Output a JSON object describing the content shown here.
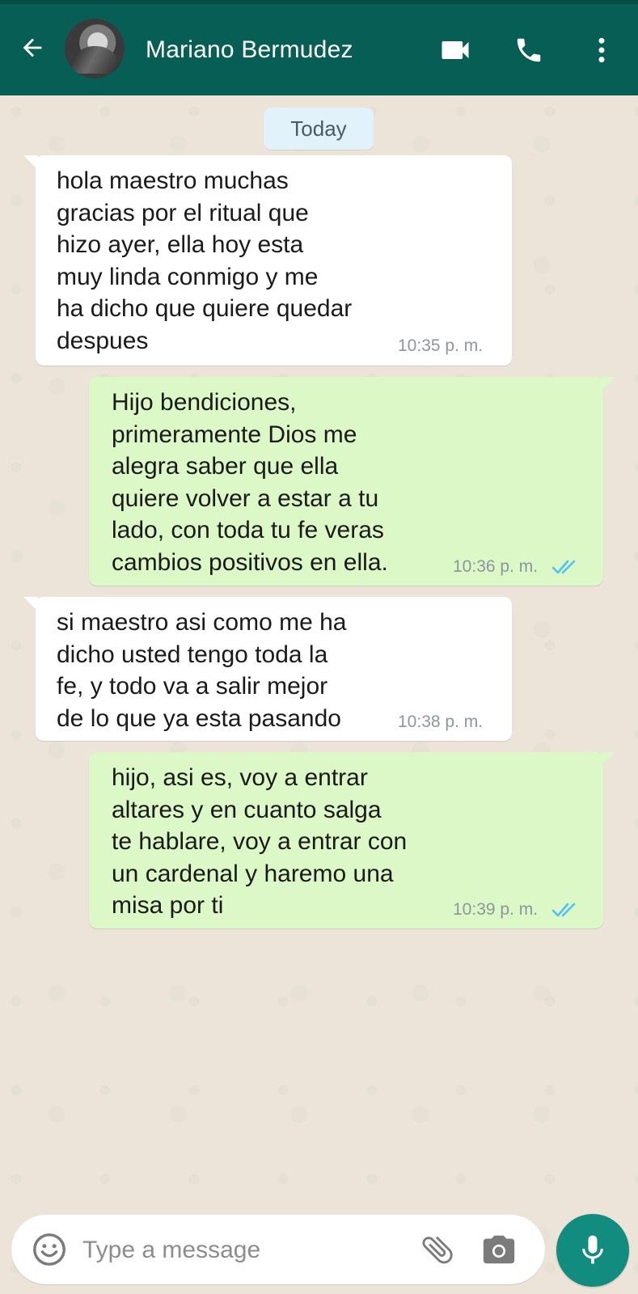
{
  "header": {
    "contact_name": "Mariano Bermudez",
    "back_icon": "arrow-left-icon",
    "icons": [
      "video-call-icon",
      "voice-call-icon",
      "more-options-icon"
    ]
  },
  "date_chip": "Today",
  "messages": [
    {
      "direction": "incoming",
      "text": "hola maestro muchas\ngracias por el ritual que\nhizo ayer, ella hoy esta\nmuy linda conmigo y me\nha dicho que quiere quedar\ndespues",
      "time": "10:35 p. m."
    },
    {
      "direction": "outgoing",
      "text": "Hijo bendiciones,\nprimeramente Dios me\nalegra saber que ella\nquiere volver a estar a tu\nlado, con toda tu fe veras\ncambios positivos en ella.",
      "time": "10:36 p. m.",
      "status": "read"
    },
    {
      "direction": "incoming",
      "text": "si maestro asi como me ha\ndicho usted tengo toda la\nfe, y todo va a salir mejor\nde lo que ya esta pasando",
      "time": "10:38 p. m."
    },
    {
      "direction": "outgoing",
      "text": "hijo, asi es, voy a entrar\naltares y en cuanto salga\nte hablare, voy a entrar con\nun cardenal y haremo una\nmisa por ti",
      "time": "10:39 p. m.",
      "status": "read"
    }
  ],
  "composer": {
    "placeholder": "Type a message",
    "value": "",
    "icons": [
      "emoji-icon",
      "attach-icon",
      "camera-icon",
      "mic-icon"
    ]
  },
  "colors": {
    "header": "#075e54",
    "outgoing_bubble": "#dcf8c6",
    "incoming_bubble": "#ffffff",
    "read_ticks": "#4fc3f7",
    "mic_button": "#128c7e"
  }
}
